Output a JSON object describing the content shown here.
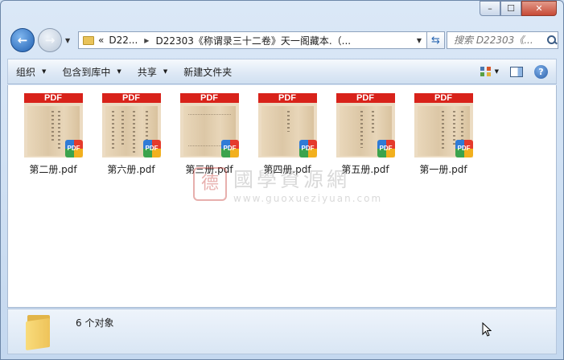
{
  "window": {
    "caption_buttons": {
      "minimize": "–",
      "maximize": "☐",
      "close": "✕"
    }
  },
  "nav": {
    "back_icon": "back-arrow-icon",
    "forward_icon": "forward-arrow-icon",
    "address": {
      "overflow": "«",
      "crumb1": "D22...",
      "crumb2": "D22303《称谓录三十二卷》天一阁藏本.（..."
    },
    "search_placeholder": "搜索 D22303《..."
  },
  "toolbar": {
    "organize": "组织",
    "include_in_library": "包含到库中",
    "share": "共享",
    "new_folder": "新建文件夹"
  },
  "files": [
    {
      "name": "第二册.pdf",
      "band": "PDF",
      "badge": "PDF"
    },
    {
      "name": "第六册.pdf",
      "band": "PDF",
      "badge": "PDF"
    },
    {
      "name": "第三册.pdf",
      "band": "PDF",
      "badge": "PDF"
    },
    {
      "name": "第四册.pdf",
      "band": "PDF",
      "badge": "PDF"
    },
    {
      "name": "第五册.pdf",
      "band": "PDF",
      "badge": "PDF"
    },
    {
      "name": "第一册.pdf",
      "band": "PDF",
      "badge": "PDF"
    }
  ],
  "watermark": {
    "seal": "德",
    "text_cn": "國學資源網",
    "text_url": "www.guoxueziyuan.com"
  },
  "status": {
    "count_text": "6 个对象"
  },
  "colors": {
    "pdf_band": "#d8221a",
    "window_frame": "#dbe8f7",
    "close_button": "#c74a36"
  }
}
